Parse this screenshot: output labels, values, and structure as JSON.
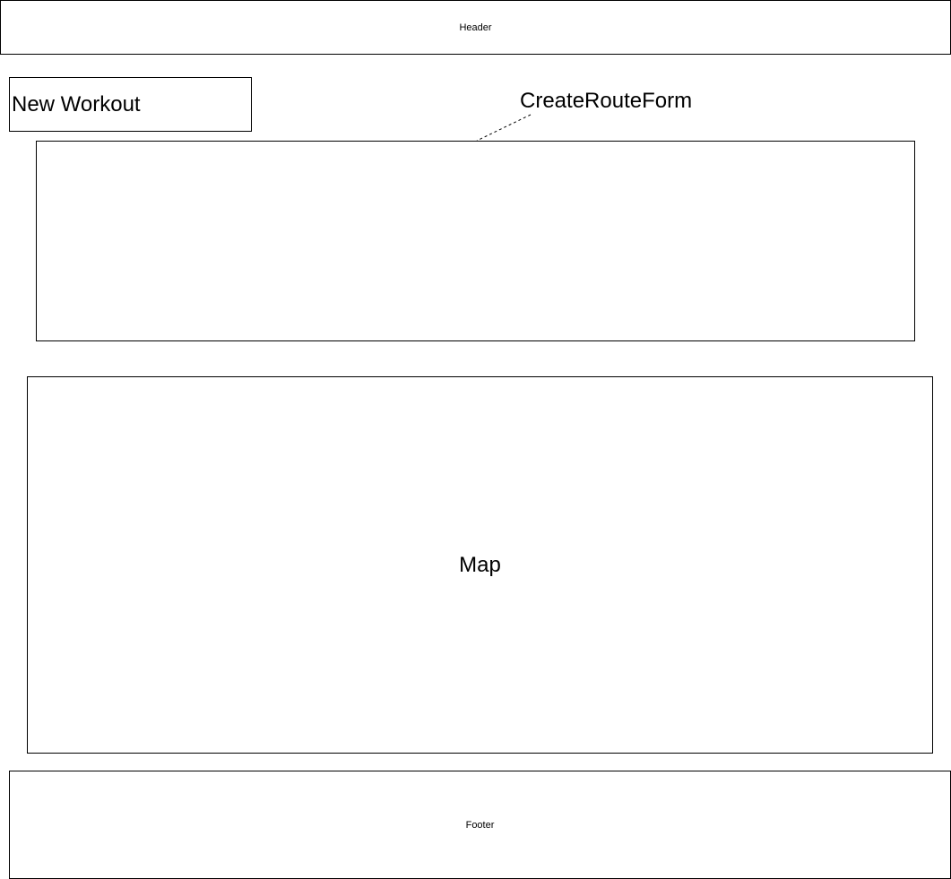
{
  "header": {
    "label": "Header"
  },
  "new_workout": {
    "label": "New Workout"
  },
  "create_route_form": {
    "label": "CreateRouteForm"
  },
  "map": {
    "label": "Map"
  },
  "footer": {
    "label": "Footer"
  }
}
